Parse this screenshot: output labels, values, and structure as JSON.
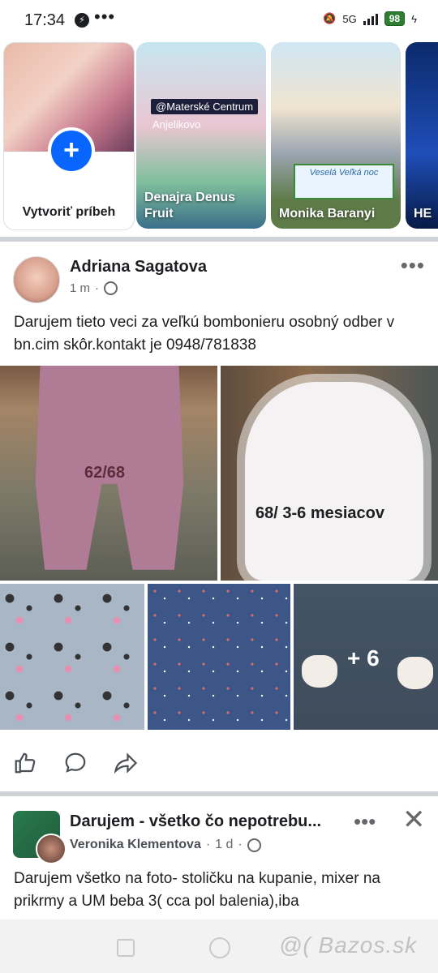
{
  "status_bar": {
    "time": "17:34",
    "battery": "98",
    "network": "5G",
    "overflow": "•••"
  },
  "stories": [
    {
      "label": "Vytvoriť príbeh",
      "type": "create"
    },
    {
      "label": "Denajra Denus Fruit",
      "overlay_tag": "@Materské Centrum",
      "overlay_text": "Anjelikovo"
    },
    {
      "label": "Monika Baranyi",
      "sign_text": "Veselá Veľká noc"
    },
    {
      "label": "HE"
    }
  ],
  "post": {
    "author": "Adriana Sagatova",
    "time": "1 m",
    "more": "•••",
    "text": "Darujem tieto veci za veľkú bombonieru osobný odber v bn.cim skôr.kontakt je 0948/781838",
    "photo_labels": {
      "photo1": "62/68",
      "photo2": "68/ 3-6  mesiacov",
      "more_count": "+ 6"
    }
  },
  "actions": {
    "like_icon": "like-icon",
    "comment_icon": "comment-icon",
    "share_icon": "share-icon"
  },
  "group_post": {
    "title": "Darujem - všetko čo nepotrebu...",
    "author": "Veronika Klementova",
    "time": "1 d",
    "more": "•••",
    "close": "✕",
    "text": "Darujem všetko na foto- stoličku na kupanie, mixer na prikrmy a UM beba 3( cca pol balenia),iba"
  },
  "nav": {
    "watermark": "@( Bazos.sk"
  },
  "colors": {
    "accent": "#0866ff",
    "divider": "#cfd3d8",
    "secondary_text": "#65676b"
  }
}
